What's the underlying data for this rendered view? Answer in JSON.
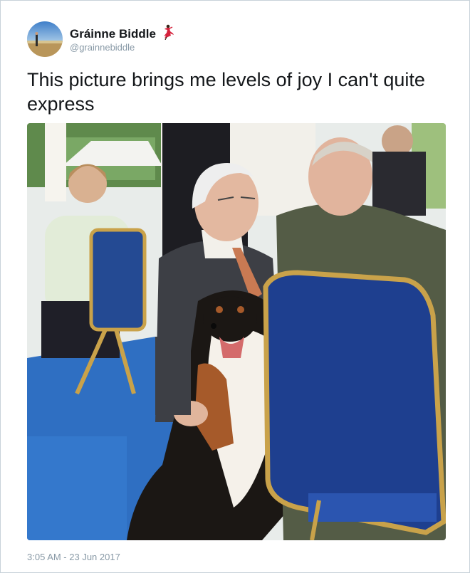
{
  "tweet": {
    "author": {
      "display_name": "Gráinne Biddle",
      "handle": "@grainnebiddle",
      "emoji_icon": "dancer-emoji-icon"
    },
    "text": "This picture brings me levels of joy I can't quite express",
    "timestamp": "3:05 AM - 23 Jun 2017"
  },
  "colors": {
    "name_text": "#14171a",
    "meta_text": "#8899a6",
    "card_border": "#c8d2da"
  }
}
